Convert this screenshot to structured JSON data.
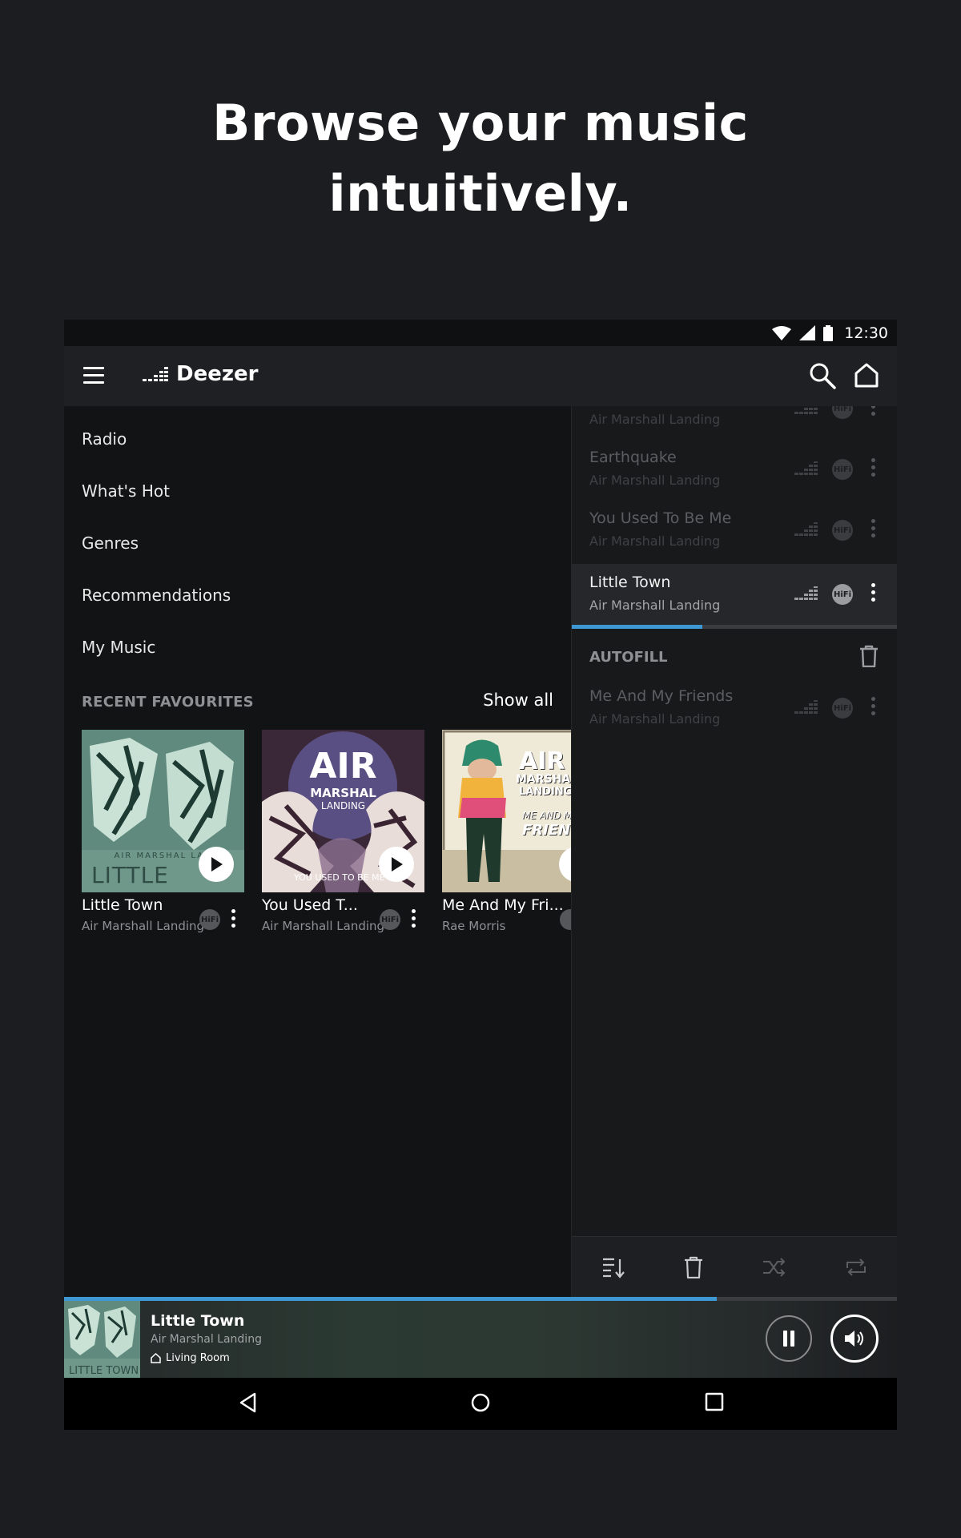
{
  "headline": {
    "line1": "Browse your music",
    "line2": "intuitively."
  },
  "status_bar": {
    "time": "12:30",
    "icons": [
      "wifi-icon",
      "signal-icon",
      "battery-icon"
    ]
  },
  "app_bar": {
    "brand": "Deezer",
    "icons": [
      "menu-icon",
      "deezer-logo-icon",
      "search-icon",
      "home-icon"
    ]
  },
  "nav_menu": {
    "items": [
      {
        "label": "Radio"
      },
      {
        "label": "What's Hot"
      },
      {
        "label": "Genres"
      },
      {
        "label": "Recommendations"
      },
      {
        "label": "My Music"
      }
    ]
  },
  "recent_favourites": {
    "title": "RECENT FAVOURITES",
    "show_all": "Show all",
    "cards": [
      {
        "title": "Little Town",
        "subtitle": "Air Marshall Landing",
        "badge": "HiFi",
        "cover_text_top": "AIR MARSHAL LAN",
        "cover_text_big": "LITTLE TOWN"
      },
      {
        "title": "You Used T...",
        "subtitle": "Air Marshall Landing",
        "badge": "HiFi",
        "cover_text_1": "AIR",
        "cover_text_2": "MARSHAL",
        "cover_text_3": "LANDING",
        "cover_text_4": "YOU USED TO BE ME"
      },
      {
        "title": "Me And My Fri...",
        "subtitle": "Rae Morris",
        "cover_text_1": "AIR",
        "cover_text_2": "MARSHAL",
        "cover_text_3": "LANDING",
        "cover_text_4": "ME AND MY",
        "cover_text_5": "FRIENDS"
      }
    ]
  },
  "queue": {
    "tracks": [
      {
        "title": "",
        "artist": "Air Marshall Landing",
        "badge": "HiFi",
        "state": "played"
      },
      {
        "title": "Earthquake",
        "artist": "Air Marshall Landing",
        "badge": "HiFi",
        "state": "played"
      },
      {
        "title": "You Used To Be Me",
        "artist": "Air Marshall Landing",
        "badge": "HiFi",
        "state": "played"
      },
      {
        "title": "Little Town",
        "artist": "Air Marshall Landing",
        "badge": "HiFi",
        "state": "playing"
      }
    ],
    "current_track_progress": 0.4,
    "autofill": {
      "title": "AUTOFILL",
      "tracks": [
        {
          "title": "Me And My Friends",
          "artist": "Air Marshall Landing",
          "badge": "HiFi"
        }
      ]
    },
    "toolbar_icons": [
      "sort-queue-icon",
      "clear-queue-icon",
      "shuffle-icon",
      "repeat-icon"
    ]
  },
  "player": {
    "title": "Little Town",
    "artist": "Air Marshal Landing",
    "room": "Living Room",
    "progress": 0.784,
    "state": "playing"
  },
  "colors": {
    "accent": "#3d97d3",
    "background": "#1c1d20",
    "panel": "#18191b"
  }
}
